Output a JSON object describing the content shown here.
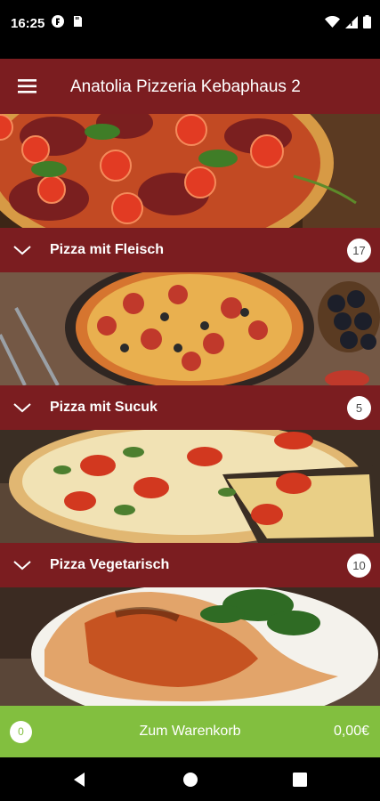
{
  "status_bar": {
    "time": "16:25",
    "left_icons": [
      "media-app-icon",
      "sd-card-icon"
    ],
    "right_icons": [
      "wifi-icon",
      "signal-icon",
      "battery-icon"
    ]
  },
  "app_bar": {
    "title": "Anatolia Pizzeria Kebaphaus 2",
    "menu_icon": "hamburger-menu-icon",
    "color": "#7b1d20"
  },
  "categories": [
    {
      "label": "Pizza mit Fleisch",
      "count": "17",
      "image": "salami-pizza-photo"
    },
    {
      "label": "Pizza mit Sucuk",
      "count": "5",
      "image": "sucuk-pizza-photo"
    },
    {
      "label": "Pizza Vegetarisch",
      "count": "10",
      "image": "vegetarian-pizza-photo"
    }
  ],
  "last_image": "calzone-photo",
  "cart": {
    "count": "0",
    "label": "Zum Warenkorb",
    "total": "0,00€",
    "color": "#82bf3f"
  },
  "nav_bar": {
    "buttons": [
      "back-icon",
      "home-icon",
      "recents-icon"
    ]
  }
}
